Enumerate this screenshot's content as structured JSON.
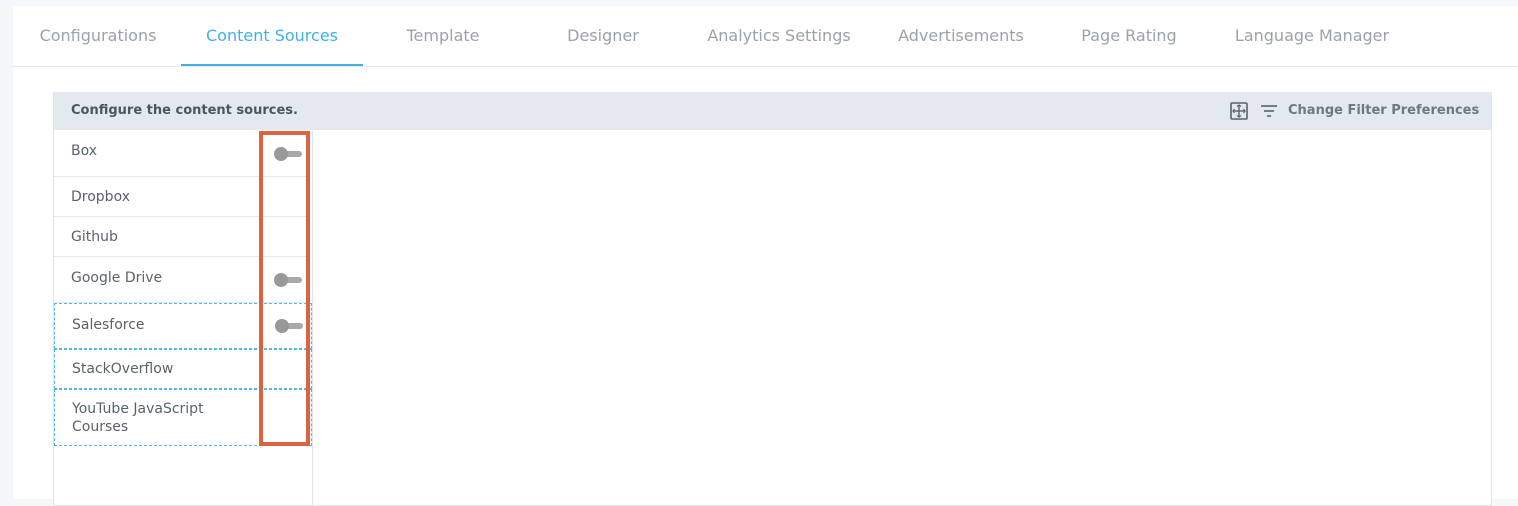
{
  "tabs": [
    {
      "label": "Configurations",
      "active": false
    },
    {
      "label": "Content Sources",
      "active": true
    },
    {
      "label": "Template",
      "active": false
    },
    {
      "label": "Designer",
      "active": false
    },
    {
      "label": "Analytics Settings",
      "active": false
    },
    {
      "label": "Advertisements",
      "active": false
    },
    {
      "label": "Page Rating",
      "active": false
    },
    {
      "label": "Language Manager",
      "active": false
    }
  ],
  "panel": {
    "title": "Configure the content sources.",
    "filter_label": "Change Filter Preferences"
  },
  "sources": [
    {
      "name": "Box",
      "has_toggle": true,
      "enabled": false
    },
    {
      "name": "Dropbox",
      "has_toggle": false
    },
    {
      "name": "Github",
      "has_toggle": false
    },
    {
      "name": "Google Drive",
      "has_toggle": true,
      "enabled": false
    },
    {
      "name": "Salesforce",
      "has_toggle": true,
      "enabled": false
    },
    {
      "name": "StackOverflow",
      "has_toggle": false
    },
    {
      "name": "YouTube JavaScript Courses",
      "has_toggle": false
    }
  ],
  "colors": {
    "accent": "#3db2e9",
    "highlight": "#dc6340",
    "toggle_off": "#a9a9a9"
  }
}
